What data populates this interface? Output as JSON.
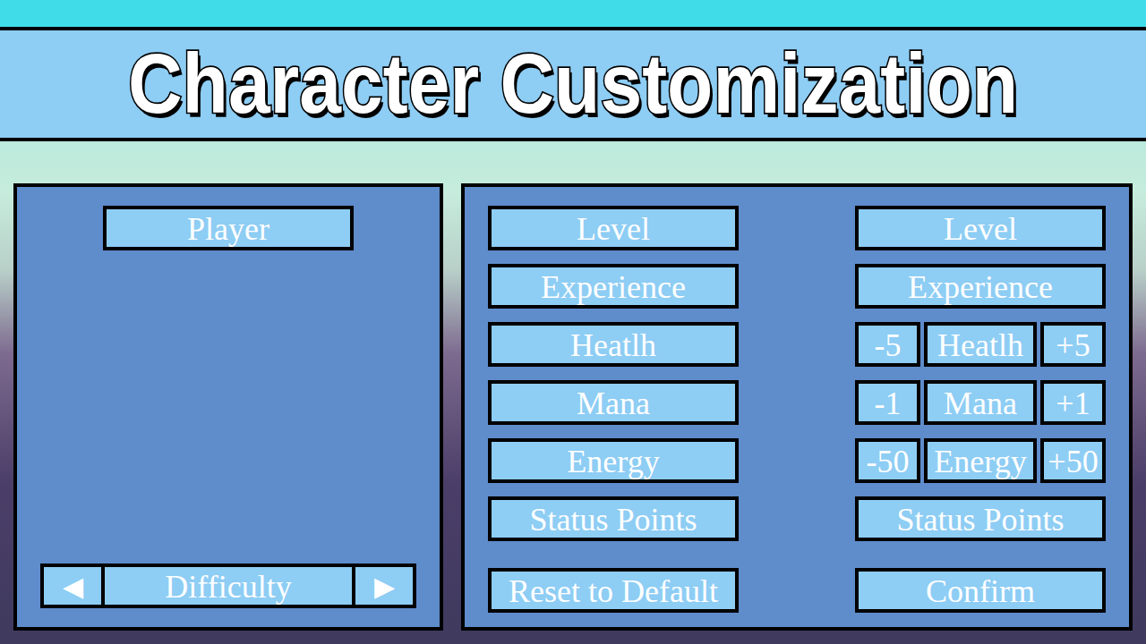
{
  "title": "Character Customization",
  "player_panel": {
    "name_label": "Player",
    "difficulty": {
      "prev": "◀",
      "label": "Difficulty",
      "next": "▶"
    }
  },
  "stats_left": [
    {
      "label": "Level"
    },
    {
      "label": "Experience"
    },
    {
      "label": "Heatlh"
    },
    {
      "label": "Mana"
    },
    {
      "label": "Energy"
    },
    {
      "label": "Status Points"
    }
  ],
  "stats_right": [
    {
      "label": "Level",
      "kind": "plain"
    },
    {
      "label": "Experience",
      "kind": "plain"
    },
    {
      "label": "Heatlh",
      "kind": "adjust",
      "minus": "-5",
      "plus": "+5"
    },
    {
      "label": "Mana",
      "kind": "adjust",
      "minus": "-1",
      "plus": "+1"
    },
    {
      "label": "Energy",
      "kind": "adjust",
      "minus": "-50",
      "plus": "+50"
    },
    {
      "label": "Status Points",
      "kind": "plain"
    }
  ],
  "buttons": {
    "reset": "Reset to Default",
    "confirm": "Confirm"
  }
}
